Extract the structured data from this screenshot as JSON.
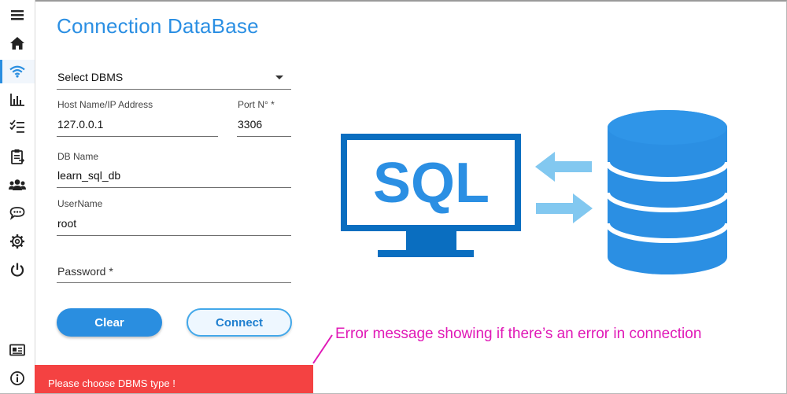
{
  "page": {
    "title": "Connection DataBase"
  },
  "sidebar": {
    "items": [
      {
        "icon": "hamburger-menu-icon"
      },
      {
        "icon": "home-icon"
      },
      {
        "icon": "wifi-icon",
        "active": true
      },
      {
        "icon": "bar-chart-icon"
      },
      {
        "icon": "checklist-icon"
      },
      {
        "icon": "clipboard-icon"
      },
      {
        "icon": "users-icon"
      },
      {
        "icon": "chat-icon"
      },
      {
        "icon": "gear-icon"
      },
      {
        "icon": "power-icon"
      },
      {
        "icon": "id-card-icon"
      },
      {
        "icon": "info-icon"
      }
    ]
  },
  "form": {
    "dbms": {
      "value": "Select DBMS"
    },
    "host": {
      "label": "Host Name/IP Address",
      "value": "127.0.0.1"
    },
    "port": {
      "label": "Port N° *",
      "value": "3306"
    },
    "db_name": {
      "label": "DB Name",
      "value": "learn_sql_db"
    },
    "username": {
      "label": "UserName",
      "value": "root"
    },
    "password": {
      "label": "Password *"
    }
  },
  "buttons": {
    "clear": "Clear",
    "connect": "Connect"
  },
  "error": {
    "message": "Please choose DBMS type !"
  },
  "annotation": {
    "text": "Error message showing if there’s an error in connection"
  },
  "illustration": {
    "monitor_text": "SQL"
  },
  "colors": {
    "accent": "#2b8fe3",
    "error": "#f44242",
    "annotation": "#e01ab7",
    "database": "#2b8fe3",
    "arrow": "#82c8f0"
  }
}
